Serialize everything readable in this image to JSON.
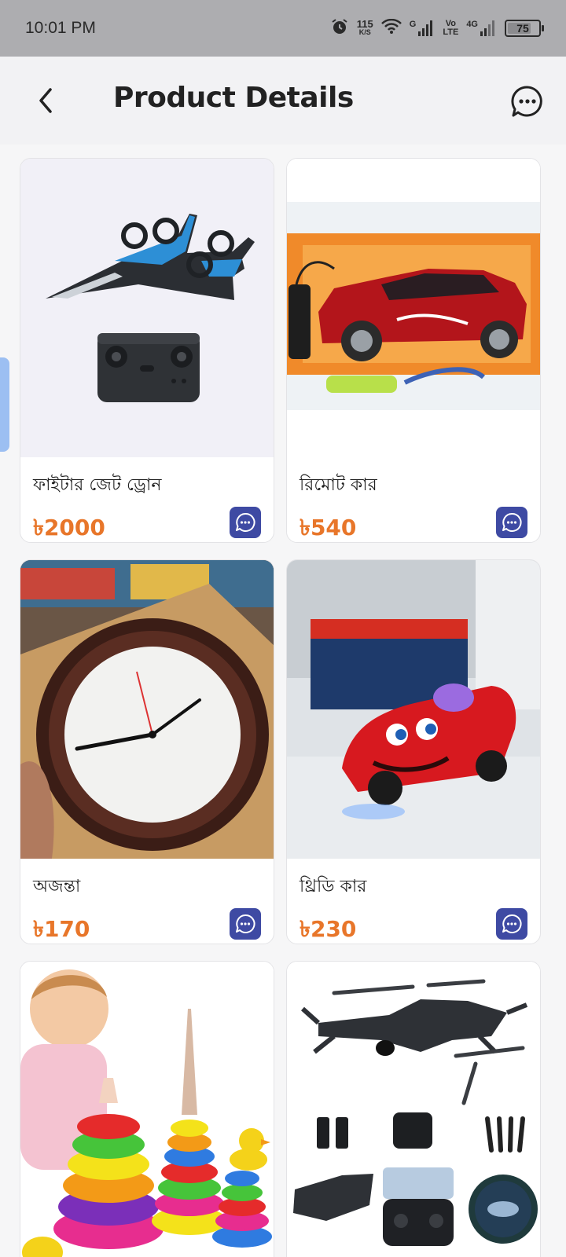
{
  "status_bar": {
    "time": "10:01 PM",
    "speed_value": "115",
    "speed_unit": "K/S",
    "sim1_label": "G",
    "volte_top": "Vo",
    "volte_bottom": "LTE",
    "sim2_label": "4G",
    "battery": "75",
    "battery_level": 0.75
  },
  "header": {
    "title": "Product Details",
    "back_icon": "chevron-left-icon",
    "chat_icon": "chat-bubble-icon"
  },
  "colors": {
    "price": "#e8762a",
    "chat_button": "#3e4aa3",
    "side_tab": "#9cbff2"
  },
  "products": [
    {
      "name": "ফাইটার জেট ড্রোন",
      "price": "৳2000",
      "image": "fighter jet drone with remote"
    },
    {
      "name": "রিমোট কার",
      "price": "৳540",
      "image": "red remote control car in box"
    },
    {
      "name": "অজন্তা",
      "price": "৳170",
      "image": "wall clock in plastic wrap"
    },
    {
      "name": "থ্রিডি কার",
      "price": "৳230",
      "image": "red toy race car with disco light"
    },
    {
      "name": "",
      "price": "",
      "image": "baby with stacking rings toy"
    },
    {
      "name": "",
      "price": "",
      "image": "folding camera drone with accessories"
    }
  ]
}
